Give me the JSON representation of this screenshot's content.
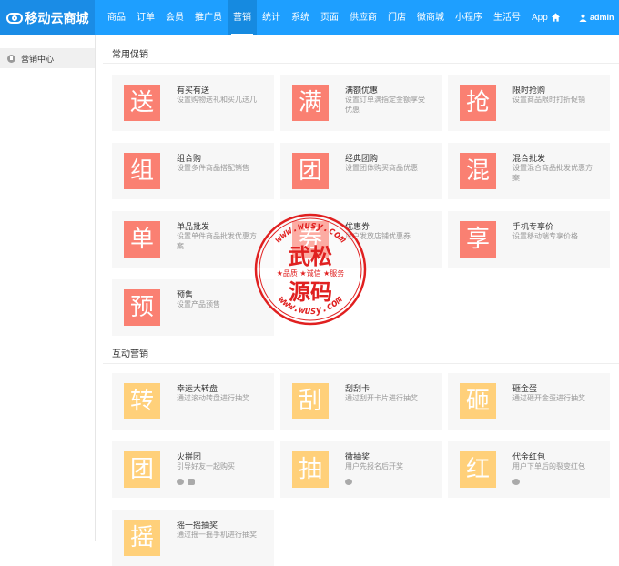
{
  "brand": {
    "name": "移动云商城",
    "logo_icon": "cloud-logo-icon"
  },
  "nav": [
    {
      "label": "商品"
    },
    {
      "label": "订单"
    },
    {
      "label": "会员"
    },
    {
      "label": "推广员"
    },
    {
      "label": "营销",
      "active": true
    },
    {
      "label": "统计"
    },
    {
      "label": "系统"
    },
    {
      "label": "页面"
    },
    {
      "label": "供应商"
    },
    {
      "label": "门店"
    },
    {
      "label": "微商城"
    },
    {
      "label": "小程序"
    },
    {
      "label": "生活号"
    },
    {
      "label": "App"
    }
  ],
  "header": {
    "home_icon": "home-icon",
    "user_icon": "user-icon",
    "user": "admin"
  },
  "sidebar": {
    "items": [
      {
        "label": "营销中心",
        "icon": "marketing-icon"
      }
    ]
  },
  "sections": [
    {
      "title": "常用促销",
      "cards": [
        {
          "glyph": "送",
          "name": "有买有送",
          "desc": "设置购物送礼和买几送几",
          "color": "red"
        },
        {
          "glyph": "满",
          "name": "满额优惠",
          "desc": "设置订单满指定金额享受优惠",
          "color": "red"
        },
        {
          "glyph": "抢",
          "name": "限时抢购",
          "desc": "设置商品限时打折促销",
          "color": "red"
        },
        {
          "glyph": "组",
          "name": "组合购",
          "desc": "设置多件商品搭配销售",
          "color": "red"
        },
        {
          "glyph": "团",
          "name": "经典团购",
          "desc": "设置团体购买商品优惠",
          "color": "red"
        },
        {
          "glyph": "混",
          "name": "混合批发",
          "desc": "设置混合商品批发优惠方案",
          "color": "red"
        },
        {
          "glyph": "单",
          "name": "单品批发",
          "desc": "设置单件商品批发优惠方案",
          "color": "red"
        },
        {
          "glyph": "券",
          "name": "优惠券",
          "desc": "用户发放店铺优惠券",
          "color": "red"
        },
        {
          "glyph": "享",
          "name": "手机专享价",
          "desc": "设置移动端专享价格",
          "color": "red"
        },
        {
          "glyph": "预",
          "name": "预售",
          "desc": "设置产品预售",
          "color": "red"
        }
      ]
    },
    {
      "title": "互动营销",
      "cards": [
        {
          "glyph": "转",
          "name": "幸运大转盘",
          "desc": "通过滚动转盘进行抽奖",
          "color": "yellow"
        },
        {
          "glyph": "刮",
          "name": "刮刮卡",
          "desc": "通过刮开卡片进行抽奖",
          "color": "yellow"
        },
        {
          "glyph": "砸",
          "name": "砸金蛋",
          "desc": "通过砸开金蛋进行抽奖",
          "color": "yellow"
        },
        {
          "glyph": "团",
          "name": "火拼团",
          "desc": "引导好友一起购买",
          "color": "yellow",
          "tags": [
            "wechat-icon",
            "image-icon"
          ]
        },
        {
          "glyph": "抽",
          "name": "微抽奖",
          "desc": "用户先报名后开奖",
          "color": "yellow",
          "tags": [
            "wechat-icon"
          ]
        },
        {
          "glyph": "红",
          "name": "代金红包",
          "desc": "用户下单后的裂变红包",
          "color": "yellow",
          "tags": [
            "wechat-icon"
          ]
        },
        {
          "glyph": "摇",
          "name": "摇一摇抽奖",
          "desc": "通过摇一摇手机进行抽奖",
          "color": "yellow"
        }
      ]
    }
  ],
  "watermark": {
    "top_text": "www.wusy.com",
    "main_top": "武松",
    "middle": "★品质 ★诚信 ★服务",
    "main_bottom": "源码",
    "bottom_text": "www.wusy.com",
    "color": "#e02020"
  },
  "colors": {
    "primary": "#1e9fff",
    "red_icon": "#fa8072",
    "yellow_icon": "#ffd07a",
    "card_bg": "#f7f7f7"
  }
}
